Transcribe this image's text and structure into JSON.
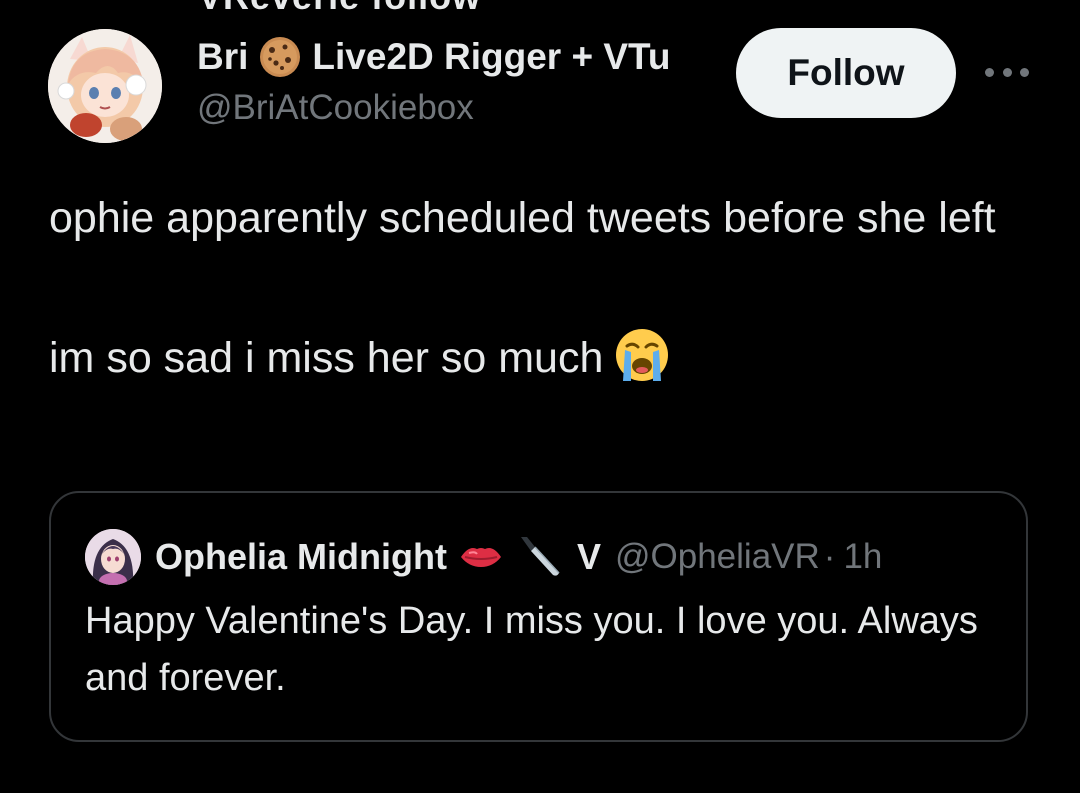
{
  "top_cut_text": "VReverie follow",
  "author": {
    "name": "Bri",
    "name_suffix": "Live2D Rigger + VTu",
    "handle": "@BriAtCookiebox",
    "avatar_icon": "anime-girl-avatar",
    "name_emoji": "cookie-emoji"
  },
  "follow_button": {
    "label": "Follow"
  },
  "more_icon": "more-dots-icon",
  "tweet": {
    "line1": "ophie apparently scheduled tweets before she left",
    "line2": "im so sad i miss her so much",
    "emoji": "loudly-crying-face-emoji"
  },
  "quote": {
    "name": "Ophelia Midnight",
    "emojis": [
      "kiss-mark-emoji",
      "knife-emoji"
    ],
    "name_suffix": "V",
    "handle": "@OpheliaVR",
    "separator": "·",
    "time": "1h",
    "text": "Happy Valentine's Day. I miss you. I love you. Always and forever."
  },
  "colors": {
    "background": "#000000",
    "text": "#e7e9ea",
    "secondary_text": "#71767b",
    "border": "#333639",
    "button_bg": "#eff3f4"
  }
}
